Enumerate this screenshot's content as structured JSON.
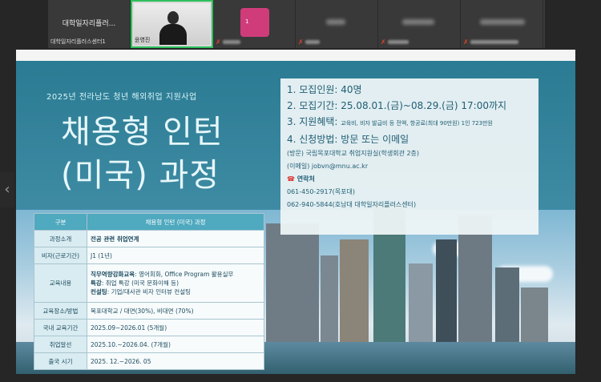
{
  "participants": [
    {
      "name": "대학일자리플러...",
      "label": "대학일자리플러스센터1",
      "muted": false
    },
    {
      "name": "",
      "label": "윤영진",
      "muted": false,
      "active": true
    },
    {
      "name": "",
      "label": "",
      "muted": true,
      "pink_initial": "1"
    },
    {
      "name": "",
      "label": "",
      "muted": true
    },
    {
      "name": "",
      "label": "",
      "muted": true
    },
    {
      "name": "",
      "label": "",
      "muted": true
    }
  ],
  "icons": {
    "mic_off": "mic-off-icon",
    "prev": "chevron-left-icon",
    "phone": "phone-icon"
  },
  "slide": {
    "subtitle": "2025년 전라남도 청년 해외취업 지원사업",
    "title_line1": "채용형 인턴",
    "title_line2": "(미국) 과정",
    "info": {
      "l1": "1. 모집인원: 40명",
      "l2": "2. 모집기간: 25.08.01.(금)~08.29.(금) 17:00까지",
      "l3_head": "3. 지원혜택: ",
      "l3_small": "교육비, 비자 발급비 등 전액, 항공료(최대 90만원) 1인 723만원",
      "l4": "4. 신청방법: 방문 또는 이메일",
      "l5": "(방문) 국립목포대학교 취업지원실(학생회관 2층)",
      "l6": "(이메일) jobvn@mnu.ac.kr",
      "contact_label": "연락처",
      "phone1": "061-450-2917(목포대)",
      "phone2": "062-940-5844(호남대 대학일자리플러스센터)"
    },
    "table": {
      "headers": [
        "구분",
        "채용형 인턴 (미국) 과정"
      ],
      "rows": [
        {
          "k": "과정소개",
          "v": "전공 관련 취업연계"
        },
        {
          "k": "비자(근로기간)",
          "v": "J1 (1년)"
        },
        {
          "k": "교육내용",
          "v1b": "직무역량강화교육",
          "v1": ": 영어회화, Office Program 활용실무",
          "v2b": "특강",
          "v2": ": 취업 특강 (미국 문화이해 등)",
          "v3b": "컨설팅",
          "v3": ": 기업/대사관 비자 인터뷰 컨설팅"
        },
        {
          "k": "교육장소/방법",
          "v": "목포대학교 / 대면(30%), 비대면 (70%)"
        },
        {
          "k": "국내 교육기간",
          "v": "2025.09~2026.01 (5개월)"
        },
        {
          "k": "취업알선",
          "v": "2025.10.~2026.04. (7개월)"
        },
        {
          "k": "출국 시기",
          "v": "2025. 12.~2026. 05"
        }
      ]
    }
  },
  "colors": {
    "accent_teal": "#2a7b93",
    "text_dark": "#1f5d74",
    "mic_off": "#e0452d",
    "active_border": "#2ec05c"
  }
}
